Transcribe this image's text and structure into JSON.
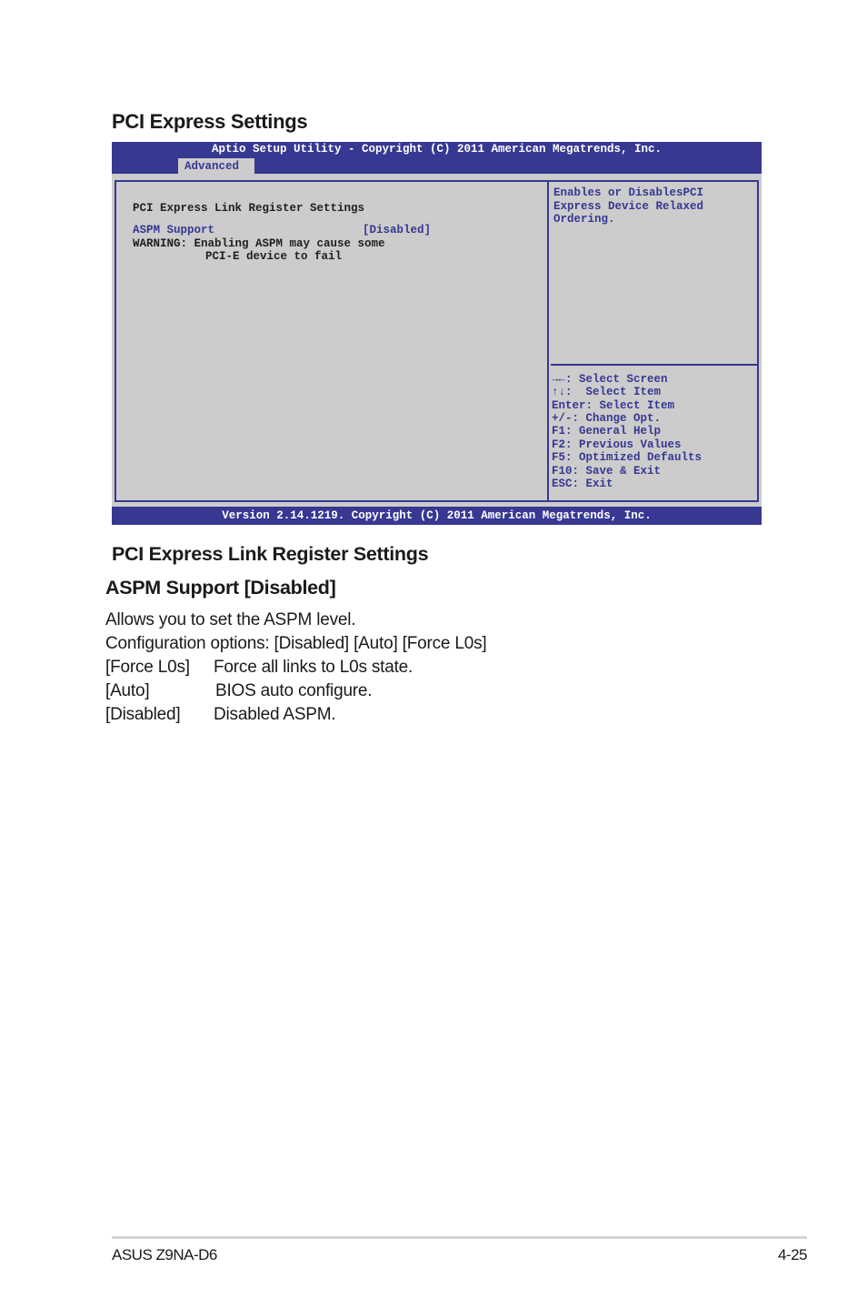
{
  "document": {
    "section_title": "PCI Express Settings"
  },
  "bios": {
    "title": "Aptio Setup Utility - Copyright (C) 2011 American Megatrends, Inc.",
    "active_tab": "Advanced",
    "main": {
      "heading": "PCI Express Link Register Settings",
      "items": [
        {
          "label": "ASPM Support",
          "value": "[Disabled]"
        }
      ],
      "warning_line1": "WARNING: Enabling ASPM may cause some",
      "warning_line2": "PCI-E device to fail"
    },
    "help_text": [
      "Enables or DisablesPCI",
      "Express Device Relaxed",
      "Ordering."
    ],
    "key_legend": [
      "→←: Select Screen",
      "↑↓:  Select Item",
      "Enter: Select Item",
      "+/-: Change Opt.",
      "F1: General Help",
      "F2: Previous Values",
      "F5: Optimized Defaults",
      "F10: Save & Exit",
      "ESC: Exit"
    ],
    "footer": "Version 2.14.1219. Copyright (C) 2011 American Megatrends, Inc."
  },
  "description": {
    "subsection_title": "PCI Express Link Register Settings",
    "setting_title": "ASPM Support [Disabled]",
    "intro": "Allows you to set the ASPM level.",
    "config_options": "Configuration options: [Disabled] [Auto] [Force L0s]",
    "options": [
      {
        "name": "[Force L0s]",
        "desc": "Force all links to L0s state."
      },
      {
        "name": "[Auto]",
        "desc": "BIOS auto configure."
      },
      {
        "name": "[Disabled]",
        "desc": "Disabled ASPM."
      }
    ]
  },
  "page_footer": {
    "model": "ASUS Z9NA-D6",
    "page_number": "4-25"
  }
}
